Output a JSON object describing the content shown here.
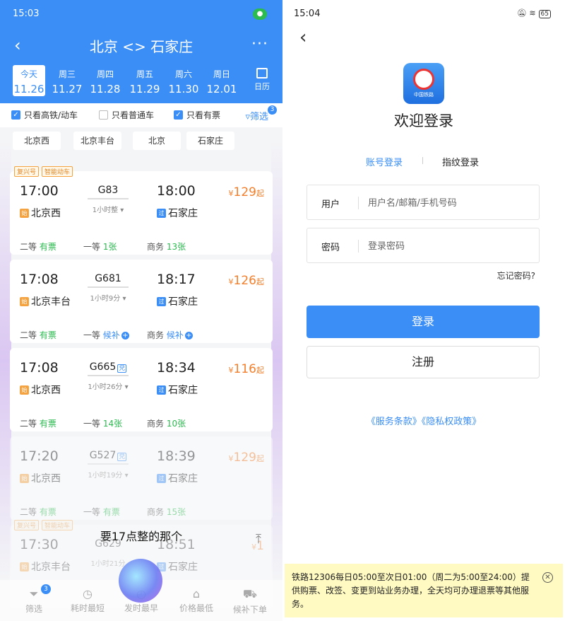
{
  "left": {
    "status_time": "15:03",
    "status_extra": "⁰",
    "route_title": "北京 <> 石家庄",
    "more": "···",
    "dates": [
      {
        "weekday": "今天",
        "date": "11.26",
        "selected": true
      },
      {
        "weekday": "周三",
        "date": "11.27"
      },
      {
        "weekday": "周四",
        "date": "11.28"
      },
      {
        "weekday": "周五",
        "date": "11.29"
      },
      {
        "weekday": "周六",
        "date": "11.30"
      },
      {
        "weekday": "周日",
        "date": "12.01"
      }
    ],
    "calendar_label": "日历",
    "filters": [
      {
        "label": "只看高铁/动车",
        "checked": true
      },
      {
        "label": "只看普通车",
        "checked": false
      },
      {
        "label": "只看有票",
        "checked": true
      }
    ],
    "filter_button": "筛选",
    "filter_badge": "3",
    "stations": [
      "北京西",
      "北京丰台",
      "北京",
      "石家庄"
    ],
    "trains": [
      {
        "tags": [
          "复兴号",
          "智能动车"
        ],
        "dep": "17:00",
        "train_no": "G83",
        "duration": "1小时整",
        "arr": "18:00",
        "price_symbol": "¥",
        "price": "129",
        "price_suffix": "起",
        "from": "北京西",
        "from_mark": "始",
        "to": "石家庄",
        "to_mark": "过",
        "seats": [
          {
            "cls": "二等",
            "status": "有票"
          },
          {
            "cls": "一等",
            "status": "1张"
          },
          {
            "cls": "商务",
            "status": "13张"
          }
        ]
      },
      {
        "dep": "17:08",
        "train_no": "G681",
        "duration": "1小时9分",
        "arr": "18:17",
        "price_symbol": "¥",
        "price": "126",
        "price_suffix": "起",
        "from": "北京丰台",
        "from_mark": "始",
        "to": "石家庄",
        "to_mark": "过",
        "seats": [
          {
            "cls": "二等",
            "status": "有票"
          },
          {
            "cls": "一等",
            "status": "候补"
          },
          {
            "cls": "商务",
            "status": "候补"
          }
        ]
      },
      {
        "dep": "17:08",
        "train_no": "G665",
        "train_badge": "兑",
        "duration": "1小时26分",
        "arr": "18:34",
        "price_symbol": "¥",
        "price": "116",
        "price_suffix": "起",
        "from": "北京西",
        "from_mark": "始",
        "to": "石家庄",
        "to_mark": "过",
        "seats": [
          {
            "cls": "二等",
            "status": "有票"
          },
          {
            "cls": "一等",
            "status": "14张"
          },
          {
            "cls": "商务",
            "status": "10张"
          }
        ]
      },
      {
        "dep": "17:20",
        "train_no": "G527",
        "train_badge": "兑",
        "duration": "1小时19分",
        "arr": "18:39",
        "price_symbol": "¥",
        "price": "129",
        "price_suffix": "起",
        "from": "北京西",
        "from_mark": "始",
        "to": "石家庄",
        "to_mark": "过",
        "seats": [
          {
            "cls": "二等",
            "status": "有票"
          },
          {
            "cls": "一等",
            "status": "有票"
          },
          {
            "cls": "商务",
            "status": "15张"
          }
        ]
      },
      {
        "tags": [
          "复兴号",
          "智能动车"
        ],
        "dep": "17:30",
        "train_no": "G629",
        "duration": "1小时21分",
        "arr": "18:51",
        "price_symbol": "¥",
        "price": "1",
        "price_suffix": "",
        "from": "北京丰台",
        "from_mark": "始",
        "to": "石家庄",
        "to_mark": "过"
      }
    ],
    "subtitle": "要17点整的那个",
    "tabbar": [
      {
        "label": "筛选",
        "icon": "funnel-icon",
        "glyph": "⏷",
        "badge": "3"
      },
      {
        "label": "耗时最短",
        "icon": "clock-icon",
        "glyph": "◷"
      },
      {
        "label": "发时最早",
        "icon": "clock-early-icon",
        "glyph": "◴"
      },
      {
        "label": "价格最低",
        "icon": "price-tag-icon",
        "glyph": "⌂"
      },
      {
        "label": "候补下单",
        "icon": "cart-icon",
        "glyph": "⛟"
      }
    ]
  },
  "right": {
    "status_time": "15:04",
    "battery": "65",
    "logo_text": "中国铁路",
    "welcome": "欢迎登录",
    "tabs": [
      "账号登录",
      "指纹登录"
    ],
    "user_label": "用户",
    "user_placeholder": "用户名/邮箱/手机号码",
    "password_label": "密码",
    "password_placeholder": "登录密码",
    "forgot": "忘记密码?",
    "login": "登录",
    "register": "注册",
    "terms": "《服务条款》《隐私权政策》",
    "notice": "铁路12306每日05:00至次日01:00（周二为5:00至24:00）提供购票、改签、变更到站业务办理，全天均可办理退票等其他服务。",
    "colors": {
      "accent": "#3a8ef6",
      "price": "#f37f2c",
      "available": "#2bbb4f",
      "notice_bg": "#fff9c2"
    }
  }
}
